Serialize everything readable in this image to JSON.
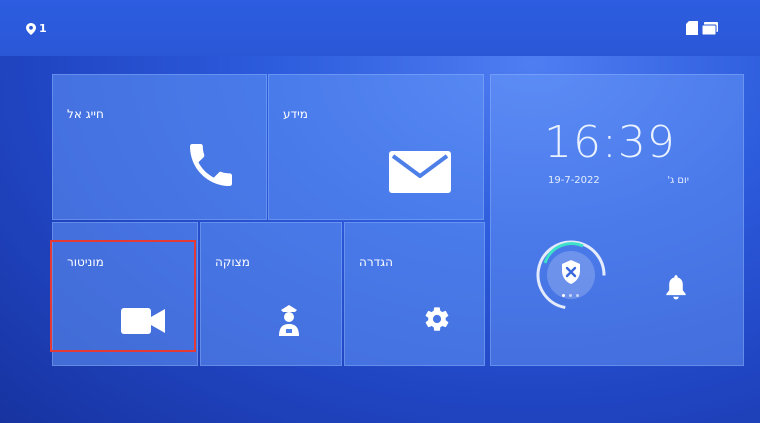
{
  "status": {
    "location_count": "1",
    "location_icon": "location-pin-icon",
    "sd_card_icon": "sd-card-icon",
    "storage_icon": "storage-icon"
  },
  "tiles": {
    "call": {
      "label": "חייג אל",
      "icon": "phone-icon"
    },
    "message": {
      "label": "מידע",
      "icon": "envelope-icon"
    },
    "monitor": {
      "label": "מוניטור",
      "icon": "video-camera-icon"
    },
    "guard": {
      "label": "מצוקה",
      "icon": "guard-icon"
    },
    "settings": {
      "label": "הגדרה",
      "icon": "gear-icon"
    }
  },
  "clock": {
    "time": "16:39",
    "date": "19-7-2022",
    "day": "יום ג'"
  },
  "quick": {
    "security_icon": "shield-disarmed-icon",
    "bell_icon": "bell-icon"
  },
  "colors": {
    "highlight": "#e53935",
    "background": "#2c5bdc"
  }
}
